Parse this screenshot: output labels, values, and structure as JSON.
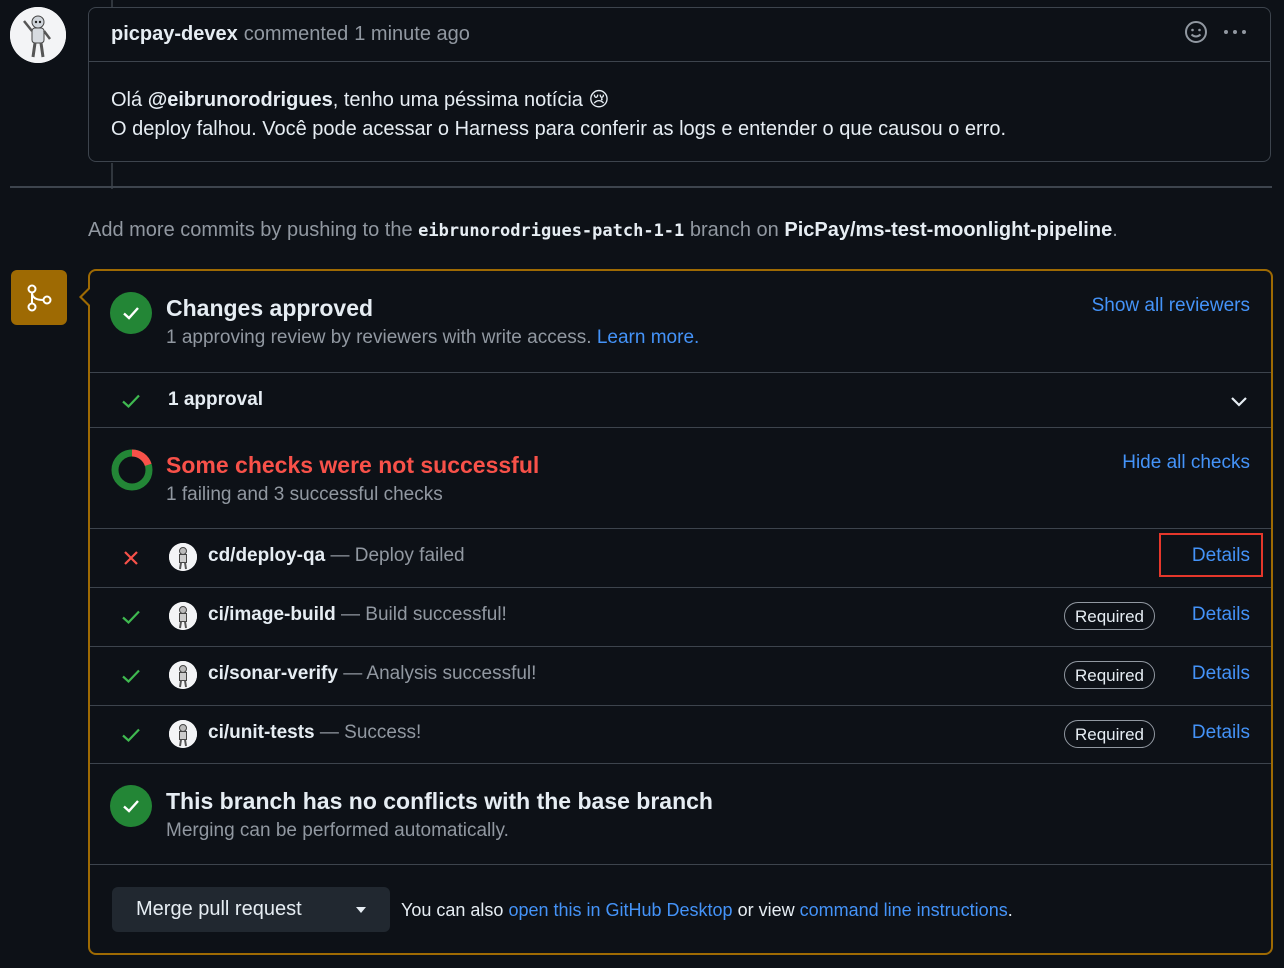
{
  "comment": {
    "author": "picpay-devex",
    "action": "commented",
    "timestamp": "1 minute ago",
    "line1_prefix": "Olá ",
    "mention": "@eibrunorodrigues",
    "line1_suffix": ", tenho uma péssima notícia",
    "emoji": "😢",
    "line2": "O deploy falhou. Você pode acessar o Harness para conferir as logs e entender o que causou o erro.",
    "icons": [
      "smiley-icon",
      "kebab-horizontal-icon"
    ]
  },
  "hint": {
    "prefix": "Add more commits by pushing to the",
    "branch": "eibrunorodrigues-patch-1-1",
    "middle": "branch on",
    "repo": "PicPay/ms-test-moonlight-pipeline",
    "suffix": "."
  },
  "reviews": {
    "title": "Changes approved",
    "subtitle": "1 approving review by reviewers with write access.",
    "learn_more": "Learn more.",
    "action": "Show all reviewers",
    "approvals_label": "1 approval"
  },
  "checks": {
    "title": "Some checks were not successful",
    "subtitle": "1 failing and 3 successful checks",
    "action": "Hide all checks",
    "items": [
      {
        "name": "cd/deploy-qa",
        "description": "— Deploy failed",
        "status": "failed",
        "required": "",
        "details": "Details"
      },
      {
        "name": "ci/image-build",
        "description": "— Build successful!",
        "status": "success",
        "required": "Required",
        "details": "Details"
      },
      {
        "name": "ci/sonar-verify",
        "description": "— Analysis successful!",
        "status": "success",
        "required": "Required",
        "details": "Details"
      },
      {
        "name": "ci/unit-tests",
        "description": "— Success!",
        "status": "success",
        "required": "Required",
        "details": "Details"
      }
    ]
  },
  "conflicts": {
    "title": "This branch has no conflicts with the base branch",
    "subtitle": "Merging can be performed automatically."
  },
  "merge": {
    "button_label": "Merge pull request",
    "hint_prefix": "You can also",
    "desktop_link": "open this in GitHub Desktop",
    "hint_middle": "or view",
    "cli_link": "command line instructions",
    "hint_suffix": "."
  },
  "colors": {
    "success": "#238636",
    "failure": "#f85149",
    "accent": "#4493f8",
    "pending": "#9e6a03",
    "highlight": "#e5372b"
  }
}
